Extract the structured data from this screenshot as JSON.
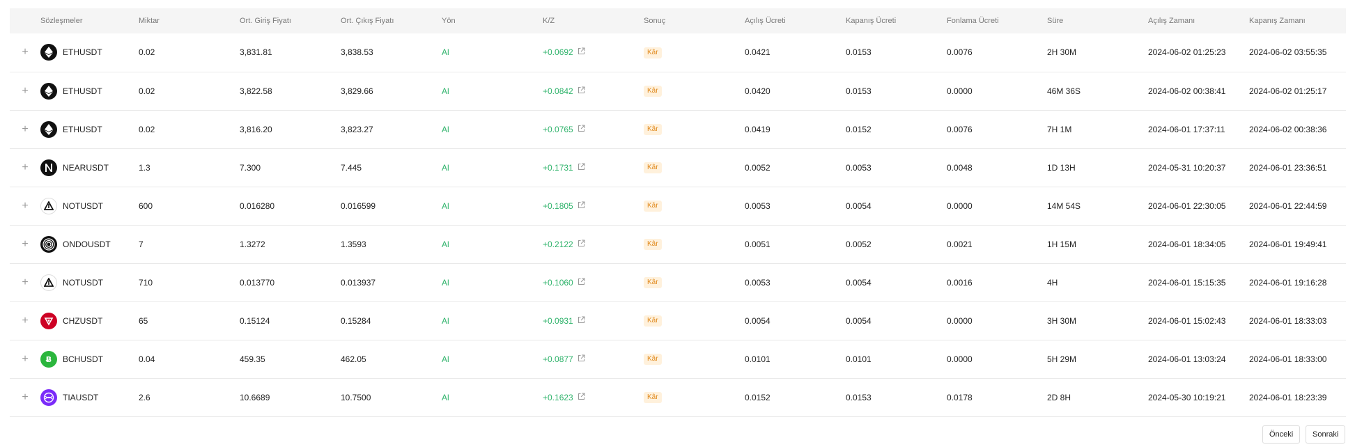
{
  "table": {
    "headers": [
      "Sözleşmeler",
      "Miktar",
      "Ort. Giriş Fiyatı",
      "Ort. Çıkış Fiyatı",
      "Yön",
      "K/Z",
      "Sonuç",
      "Açılış Ücreti",
      "Kapanış Ücreti",
      "Fonlama Ücreti",
      "Süre",
      "Açılış Zamanı",
      "Kapanış Zamanı"
    ],
    "expand_glyph": "+",
    "rows": [
      {
        "symbol": "ETHUSDT",
        "icon": "eth-icon",
        "qty": "0.02",
        "entry": "3,831.81",
        "exit": "3,838.53",
        "side": "Al",
        "pnl": "+0.0692",
        "result": "Kâr",
        "open_fee": "0.0421",
        "close_fee": "0.0153",
        "funding_fee": "0.0076",
        "duration": "2H 30M",
        "open_time": "2024-06-02 01:25:23",
        "close_time": "2024-06-02 03:55:35"
      },
      {
        "symbol": "ETHUSDT",
        "icon": "eth-icon",
        "qty": "0.02",
        "entry": "3,822.58",
        "exit": "3,829.66",
        "side": "Al",
        "pnl": "+0.0842",
        "result": "Kâr",
        "open_fee": "0.0420",
        "close_fee": "0.0153",
        "funding_fee": "0.0000",
        "duration": "46M 36S",
        "open_time": "2024-06-02 00:38:41",
        "close_time": "2024-06-02 01:25:17"
      },
      {
        "symbol": "ETHUSDT",
        "icon": "eth-icon",
        "qty": "0.02",
        "entry": "3,816.20",
        "exit": "3,823.27",
        "side": "Al",
        "pnl": "+0.0765",
        "result": "Kâr",
        "open_fee": "0.0419",
        "close_fee": "0.0152",
        "funding_fee": "0.0076",
        "duration": "7H 1M",
        "open_time": "2024-06-01 17:37:11",
        "close_time": "2024-06-02 00:38:36"
      },
      {
        "symbol": "NEARUSDT",
        "icon": "near-icon",
        "qty": "1.3",
        "entry": "7.300",
        "exit": "7.445",
        "side": "Al",
        "pnl": "+0.1731",
        "result": "Kâr",
        "open_fee": "0.0052",
        "close_fee": "0.0053",
        "funding_fee": "0.0048",
        "duration": "1D 13H",
        "open_time": "2024-05-31 10:20:37",
        "close_time": "2024-06-01 23:36:51"
      },
      {
        "symbol": "NOTUSDT",
        "icon": "notcoin-icon",
        "qty": "600",
        "entry": "0.016280",
        "exit": "0.016599",
        "side": "Al",
        "pnl": "+0.1805",
        "result": "Kâr",
        "open_fee": "0.0053",
        "close_fee": "0.0054",
        "funding_fee": "0.0000",
        "duration": "14M 54S",
        "open_time": "2024-06-01 22:30:05",
        "close_time": "2024-06-01 22:44:59"
      },
      {
        "symbol": "ONDOUSDT",
        "icon": "ondo-icon",
        "qty": "7",
        "entry": "1.3272",
        "exit": "1.3593",
        "side": "Al",
        "pnl": "+0.2122",
        "result": "Kâr",
        "open_fee": "0.0051",
        "close_fee": "0.0052",
        "funding_fee": "0.0021",
        "duration": "1H 15M",
        "open_time": "2024-06-01 18:34:05",
        "close_time": "2024-06-01 19:49:41"
      },
      {
        "symbol": "NOTUSDT",
        "icon": "notcoin-icon",
        "qty": "710",
        "entry": "0.013770",
        "exit": "0.013937",
        "side": "Al",
        "pnl": "+0.1060",
        "result": "Kâr",
        "open_fee": "0.0053",
        "close_fee": "0.0054",
        "funding_fee": "0.0016",
        "duration": "4H",
        "open_time": "2024-06-01 15:15:35",
        "close_time": "2024-06-01 19:16:28"
      },
      {
        "symbol": "CHZUSDT",
        "icon": "chiliz-icon",
        "qty": "65",
        "entry": "0.15124",
        "exit": "0.15284",
        "side": "Al",
        "pnl": "+0.0931",
        "result": "Kâr",
        "open_fee": "0.0054",
        "close_fee": "0.0054",
        "funding_fee": "0.0000",
        "duration": "3H 30M",
        "open_time": "2024-06-01 15:02:43",
        "close_time": "2024-06-01 18:33:03"
      },
      {
        "symbol": "BCHUSDT",
        "icon": "bitcoin-cash-icon",
        "qty": "0.04",
        "entry": "459.35",
        "exit": "462.05",
        "side": "Al",
        "pnl": "+0.0877",
        "result": "Kâr",
        "open_fee": "0.0101",
        "close_fee": "0.0101",
        "funding_fee": "0.0000",
        "duration": "5H 29M",
        "open_time": "2024-06-01 13:03:24",
        "close_time": "2024-06-01 18:33:00"
      },
      {
        "symbol": "TIAUSDT",
        "icon": "celestia-icon",
        "qty": "2.6",
        "entry": "10.6689",
        "exit": "10.7500",
        "side": "Al",
        "pnl": "+0.1623",
        "result": "Kâr",
        "open_fee": "0.0152",
        "close_fee": "0.0153",
        "funding_fee": "0.0178",
        "duration": "2D 8H",
        "open_time": "2024-05-30 10:19:21",
        "close_time": "2024-06-01 18:23:39"
      }
    ]
  },
  "pagination": {
    "prev_label": "Önceki",
    "next_label": "Sonraki"
  },
  "colors": {
    "positive": "#2fb36b",
    "badge_bg": "#fff1dc",
    "badge_text": "#e0891c",
    "header_bg": "#f5f5f5"
  }
}
